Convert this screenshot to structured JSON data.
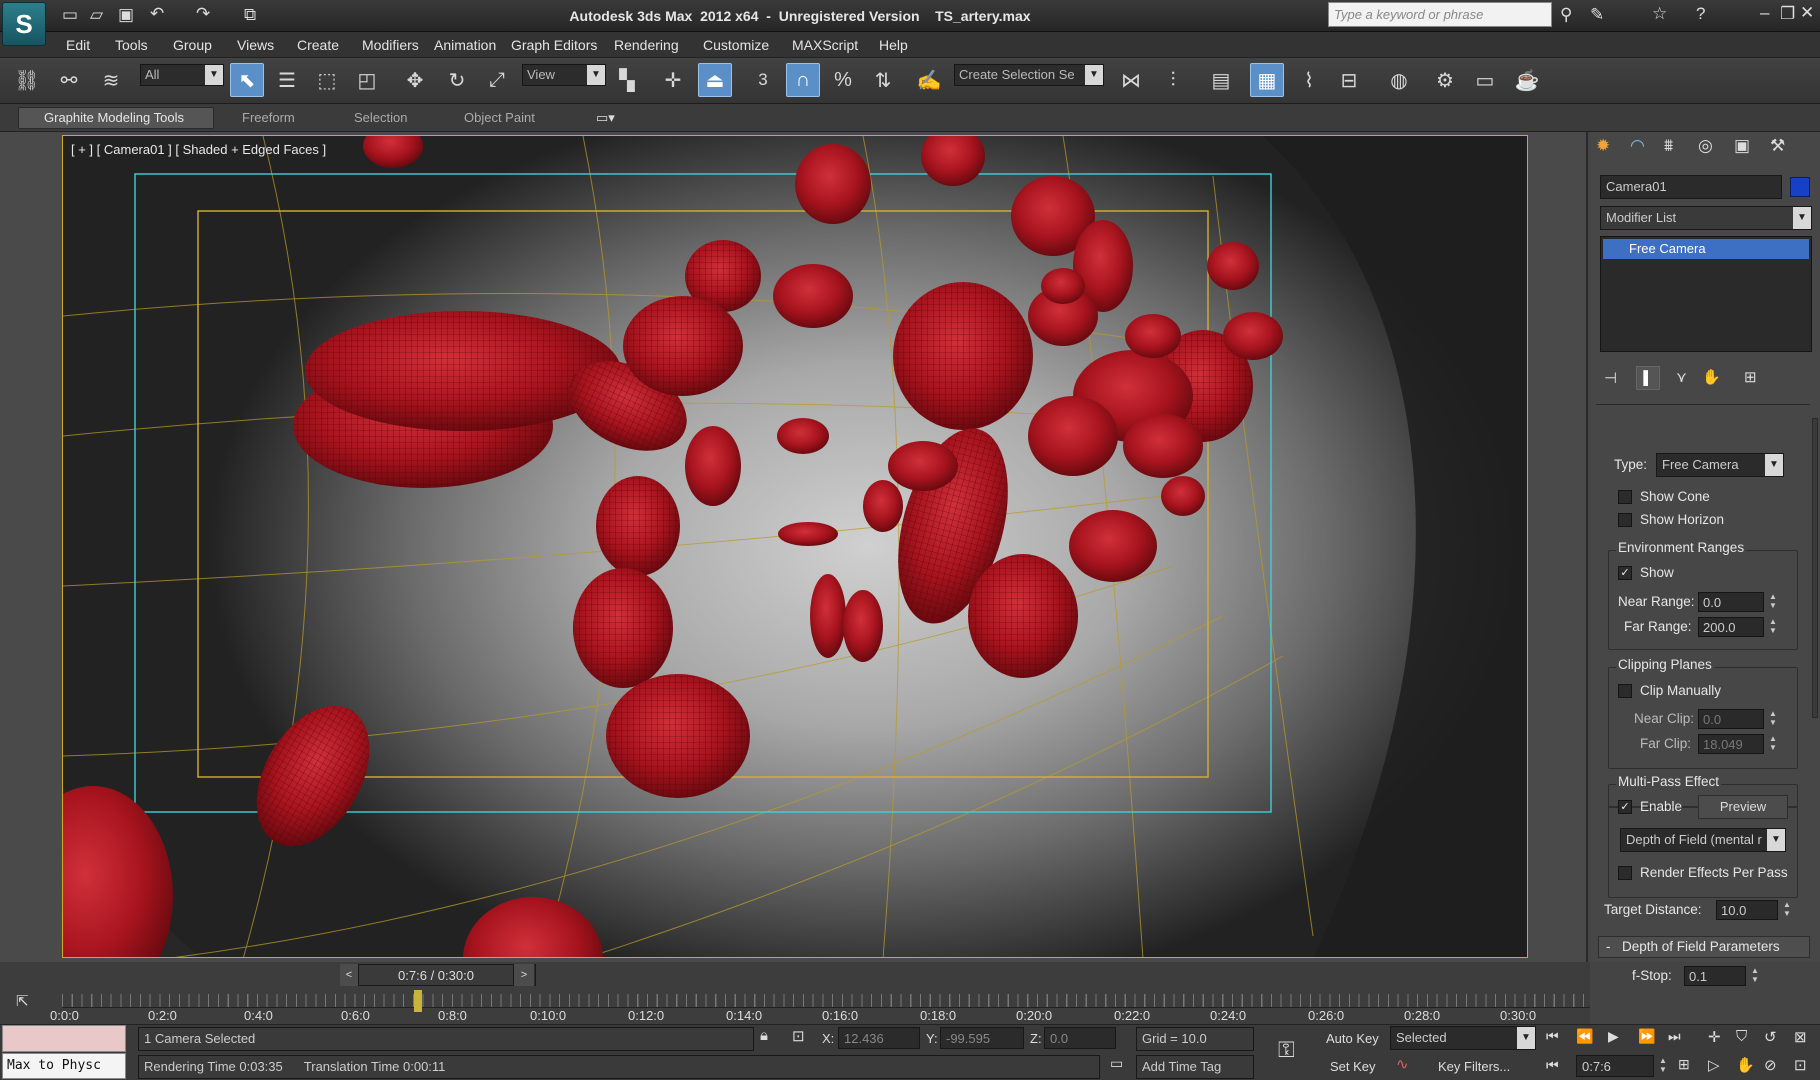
{
  "title": "Autodesk 3ds Max  2012 x64  -  Unregistered Version    TS_artery.max",
  "search": {
    "placeholder": "Type a keyword or phrase"
  },
  "menu": [
    "Edit",
    "Tools",
    "Group",
    "Views",
    "Create",
    "Modifiers",
    "Animation",
    "Graph Editors",
    "Rendering",
    "Customize",
    "MAXScript",
    "Help"
  ],
  "toolbar": {
    "filter": "All",
    "coord": "View",
    "selection_set": "Create Selection Se"
  },
  "ribbon": {
    "tabs": [
      "Graphite Modeling Tools",
      "Freeform",
      "Selection",
      "Object Paint"
    ]
  },
  "viewport": {
    "label": "[ + ] [ Camera01 ] [ Shaded + Edged Faces ]"
  },
  "panel": {
    "object_name": "Camera01",
    "object_color": "#1640c8",
    "modifier_list": "Modifier List",
    "stack_item": "Free Camera",
    "type_label": "Type:",
    "type_value": "Free Camera",
    "show_cone": "Show Cone",
    "show_horizon": "Show Horizon",
    "env_group": "Environment Ranges",
    "env_show": "Show",
    "near_range_label": "Near Range:",
    "near_range": "0.0",
    "far_range_label": "Far Range:",
    "far_range": "200.0",
    "clip_group": "Clipping Planes",
    "clip_manually": "Clip Manually",
    "near_clip_label": "Near Clip:",
    "near_clip": "0.0",
    "far_clip_label": "Far Clip:",
    "far_clip": "18.049",
    "multipass_group": "Multi-Pass Effect",
    "enable": "Enable",
    "preview": "Preview",
    "effect": "Depth of Field (mental r",
    "render_effects": "Render Effects Per Pass",
    "target_distance_label": "Target Distance:",
    "target_distance": "10.0",
    "dof_rollout": "Depth of Field Parameters",
    "dof_rollout_toggle": "-",
    "fstop_label": "f-Stop:",
    "fstop": "0.1"
  },
  "timeline": {
    "slider_text": "0:7:6 / 0:30:0",
    "ticks": [
      "0:0:0",
      "0:2:0",
      "0:4:0",
      "0:6:0",
      "0:8:0",
      "0:10:0",
      "0:12:0",
      "0:14:0",
      "0:16:0",
      "0:18:0",
      "0:20:0",
      "0:22:0",
      "0:24:0",
      "0:26:0",
      "0:28:0",
      "0:30:0"
    ]
  },
  "status": {
    "listener": "Max to Physc",
    "selection": "1 Camera Selected",
    "prompt1": "Rendering Time  0:03:35",
    "prompt2": "Translation Time  0:00:11",
    "x_label": "X:",
    "x": "12.436",
    "y_label": "Y:",
    "y": "-99.595",
    "z_label": "Z:",
    "z": "0.0",
    "grid": "Grid = 10.0",
    "add_time_tag": "Add Time Tag",
    "auto_key": "Auto Key",
    "set_key": "Set Key",
    "key_mode": "Selected",
    "key_filters": "Key Filters...",
    "current_frame": "0:7:6"
  }
}
